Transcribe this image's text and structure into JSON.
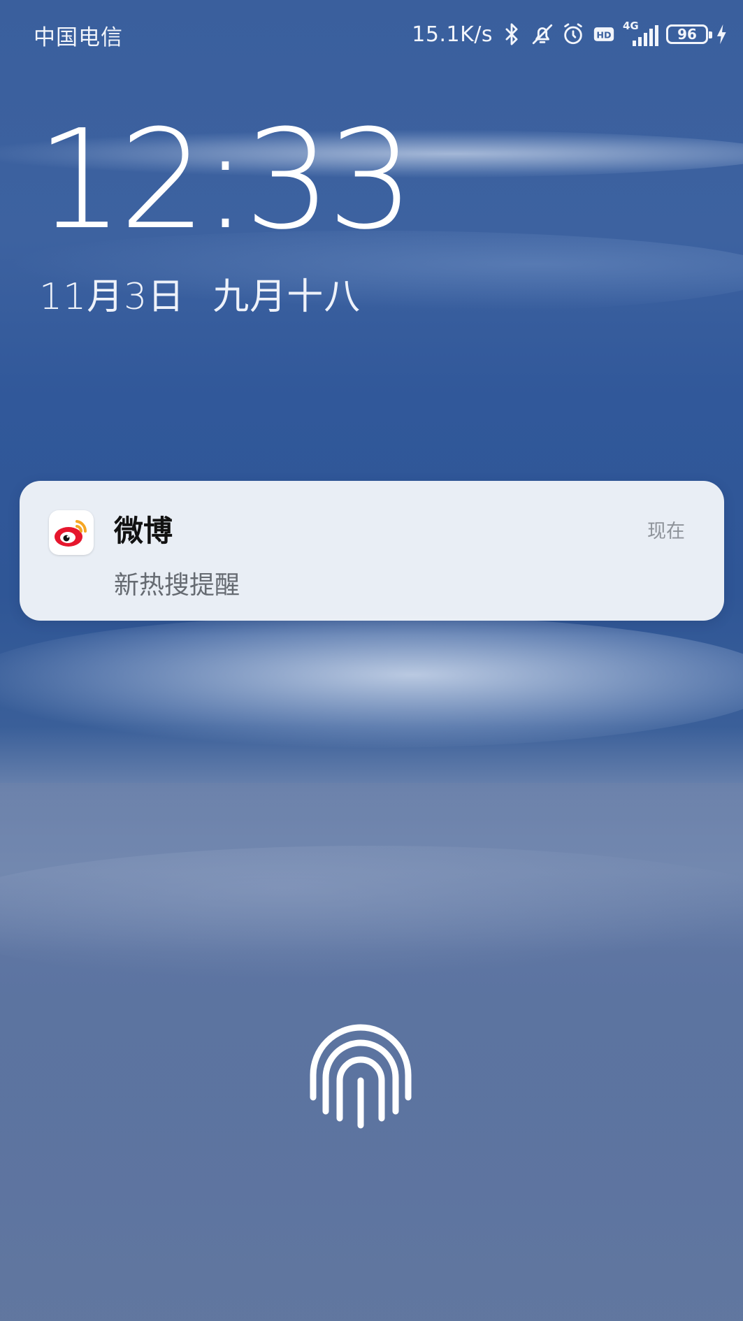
{
  "status_bar": {
    "carrier": "中国电信",
    "net_speed": "15.1K/s",
    "network_type": "4G",
    "battery_level": "96",
    "icons": [
      "bluetooth-icon",
      "mute-bell-icon",
      "alarm-icon",
      "hd-icon",
      "signal-icon",
      "battery-icon",
      "charging-icon"
    ]
  },
  "lockscreen": {
    "time": "12:33",
    "date": "11月3日",
    "lunar_date": "九月十八"
  },
  "notification": {
    "app_name": "微博",
    "time": "现在",
    "message": "新热搜提醒",
    "app_icon": "weibo-icon"
  },
  "unlock": {
    "icon": "fingerprint-icon"
  }
}
